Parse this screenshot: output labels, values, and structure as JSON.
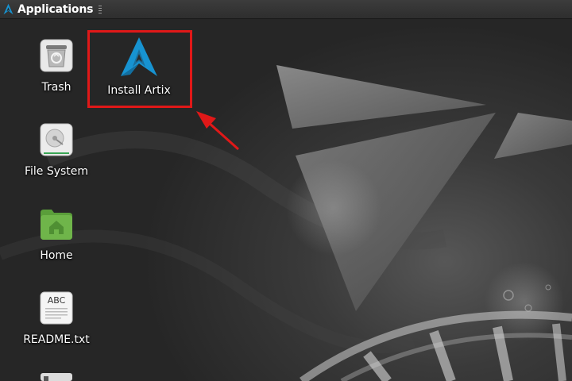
{
  "panel": {
    "menu_label": "Applications"
  },
  "desktop": {
    "icons": [
      {
        "label": "Trash",
        "icon": "trash-icon"
      },
      {
        "label": "Install Artix",
        "icon": "artix-logo-icon"
      },
      {
        "label": "File System",
        "icon": "hard-drive-icon"
      },
      {
        "label": "Home",
        "icon": "home-folder-icon"
      },
      {
        "label": "README.txt",
        "icon": "text-file-icon",
        "icon_text": "ABC"
      }
    ]
  },
  "colors": {
    "artix_blue": "#1793d1",
    "highlight_red": "#e01818",
    "panel_bg": "#333333"
  }
}
